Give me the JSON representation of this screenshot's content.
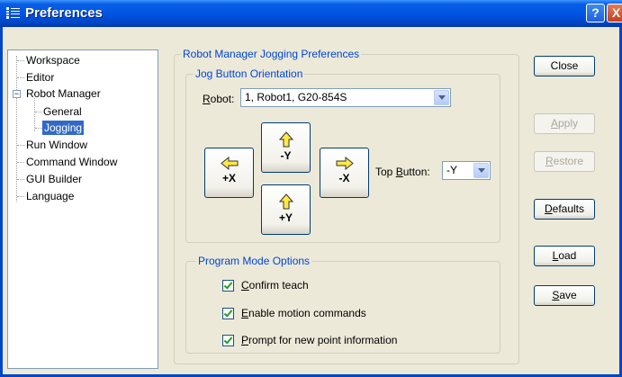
{
  "window": {
    "title": "Preferences",
    "help_label": "?",
    "close_label": "X"
  },
  "tree": {
    "items": [
      {
        "label": "Workspace"
      },
      {
        "label": "Editor"
      },
      {
        "label": "Robot Manager",
        "expander": "−"
      },
      {
        "label": "General"
      },
      {
        "label": "Jogging",
        "selected": true
      },
      {
        "label": "Run Window"
      },
      {
        "label": "Command Window"
      },
      {
        "label": "GUI Builder"
      },
      {
        "label": "Language"
      }
    ]
  },
  "jogging": {
    "group_title": "Robot Manager Jogging Preferences",
    "orientation": {
      "title": "Jog Button Orientation",
      "robot_label_prefix": "R",
      "robot_label_rest": "obot:",
      "robot_value": "1, Robot1, G20-854S",
      "buttons": {
        "up": "-Y",
        "left": "+X",
        "right": "-X",
        "down": "+Y"
      },
      "top_button_prefix": "Top ",
      "top_button_u": "B",
      "top_button_rest": "utton:",
      "top_button_value": "-Y"
    },
    "program_mode": {
      "title": "Program Mode Options",
      "options": [
        {
          "u": "C",
          "rest": "onfirm teach",
          "checked": true
        },
        {
          "u": "E",
          "rest": "nable motion commands",
          "checked": true
        },
        {
          "u": "P",
          "rest": "rompt for new point information",
          "checked": true
        }
      ]
    }
  },
  "buttons": {
    "close": "Close",
    "apply_u": "A",
    "apply_rest": "pply",
    "restore_u": "R",
    "restore_rest": "estore",
    "defaults_u": "D",
    "defaults_rest": "efaults",
    "load_u": "L",
    "load_rest": "oad",
    "save_u": "S",
    "save_rest": "ave"
  },
  "colors": {
    "title_bar": "#0054E3",
    "dialog_bg": "#ECE9D8",
    "group_title": "#0046D5",
    "arrow_fill": "#FFE94A",
    "check_mark": "#21A121",
    "selection": "#316AC5"
  }
}
